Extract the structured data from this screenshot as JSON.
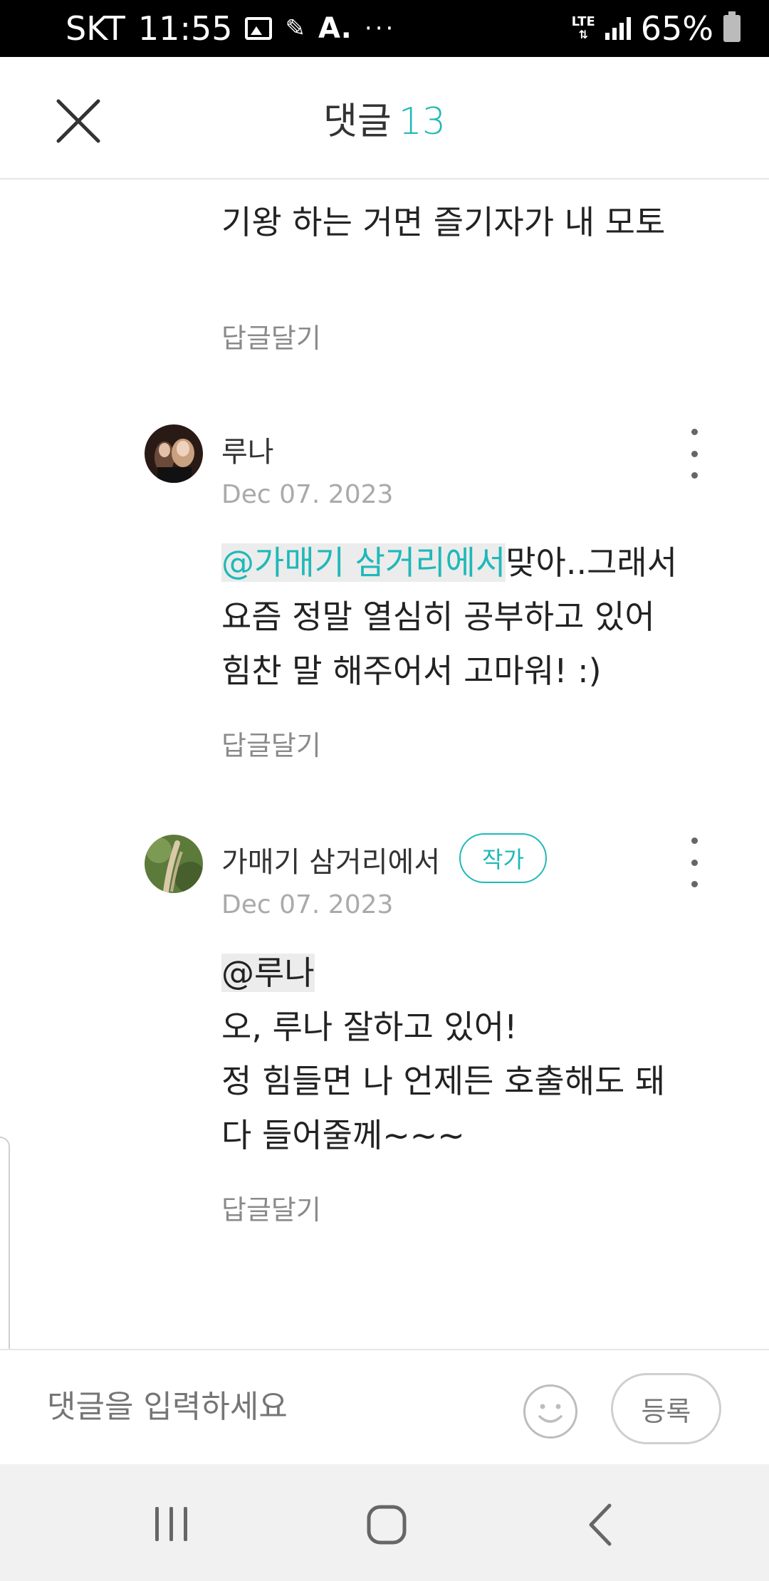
{
  "status_bar": {
    "carrier": "SKT",
    "time": "11:55",
    "network": "LTE",
    "battery": "65%",
    "icons": [
      "image-icon",
      "pen-icon",
      "font-icon",
      "more-dots-icon",
      "lte-icon",
      "signal-icon",
      "battery-icon"
    ]
  },
  "header": {
    "title": "댓글",
    "count": "13",
    "close_icon": "close-icon"
  },
  "comments": [
    {
      "text": "기왕 하는 거면 즐기자가 내 모토",
      "reply_label": "답글달기"
    },
    {
      "author": "루나",
      "date": "Dec 07. 2023",
      "mention": "@가매기 삼거리에서",
      "line1": "맞아..그래서",
      "line2": "요즘 정말 열심히 공부하고 있어",
      "line3": "힘찬 말 해주어서 고마워! :)",
      "reply_label": "답글달기"
    },
    {
      "author": "가매기 삼거리에서",
      "badge": "작가",
      "date": "Dec 07. 2023",
      "mention": "@루나",
      "line1": "오, 루나 잘하고 있어!",
      "line2": "정 힘들면 나 언제든 호출해도 돼",
      "line3": "다 들어줄께~~~",
      "reply_label": "답글달기"
    }
  ],
  "input_bar": {
    "placeholder": "댓글을 입력하세요",
    "submit_label": "등록",
    "emoji_icon": "smiley-icon"
  },
  "nav_bar": {
    "icons": [
      "recent-apps-icon",
      "home-icon",
      "back-icon"
    ]
  },
  "colors": {
    "accent": "#20b8b8",
    "status_bar_bg": "#000000",
    "nav_bar_bg": "#f1f1f1"
  }
}
